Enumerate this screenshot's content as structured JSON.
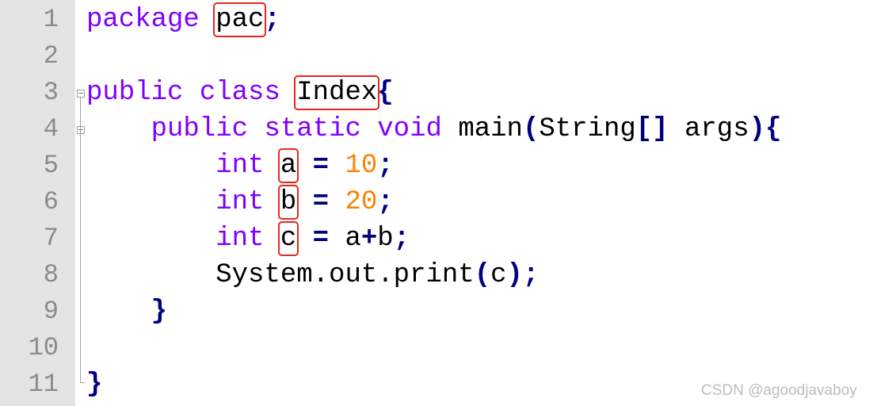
{
  "editor": {
    "lines": [
      {
        "n": "1",
        "tokens": [
          [
            "kw",
            "package"
          ],
          [
            "sp",
            " "
          ],
          [
            "box",
            "pac"
          ],
          [
            "op",
            ";"
          ]
        ]
      },
      {
        "n": "2",
        "tokens": []
      },
      {
        "n": "3",
        "tokens": [
          [
            "kw",
            "public"
          ],
          [
            "sp",
            " "
          ],
          [
            "kw",
            "class"
          ],
          [
            "sp",
            " "
          ],
          [
            "box",
            "Index"
          ],
          [
            "op",
            "{"
          ]
        ]
      },
      {
        "n": "4",
        "tokens": [
          [
            "sp",
            "    "
          ],
          [
            "kw",
            "public"
          ],
          [
            "sp",
            " "
          ],
          [
            "kw",
            "static"
          ],
          [
            "sp",
            " "
          ],
          [
            "kw",
            "void"
          ],
          [
            "sp",
            " "
          ],
          [
            "txt",
            "main"
          ],
          [
            "op",
            "("
          ],
          [
            "txt",
            "String"
          ],
          [
            "op",
            "[]"
          ],
          [
            "sp",
            " "
          ],
          [
            "txt",
            "args"
          ],
          [
            "op",
            ")"
          ],
          [
            "op",
            "{"
          ]
        ]
      },
      {
        "n": "5",
        "tokens": [
          [
            "sp",
            "        "
          ],
          [
            "kw",
            "int"
          ],
          [
            "sp",
            " "
          ],
          [
            "box",
            "a"
          ],
          [
            "sp",
            " "
          ],
          [
            "op",
            "="
          ],
          [
            "sp",
            " "
          ],
          [
            "num",
            "10"
          ],
          [
            "op",
            ";"
          ]
        ]
      },
      {
        "n": "6",
        "tokens": [
          [
            "sp",
            "        "
          ],
          [
            "kw",
            "int"
          ],
          [
            "sp",
            " "
          ],
          [
            "box",
            "b"
          ],
          [
            "sp",
            " "
          ],
          [
            "op",
            "="
          ],
          [
            "sp",
            " "
          ],
          [
            "num",
            "20"
          ],
          [
            "op",
            ";"
          ]
        ]
      },
      {
        "n": "7",
        "tokens": [
          [
            "sp",
            "        "
          ],
          [
            "kw",
            "int"
          ],
          [
            "sp",
            " "
          ],
          [
            "box",
            "c"
          ],
          [
            "sp",
            " "
          ],
          [
            "op",
            "="
          ],
          [
            "sp",
            " "
          ],
          [
            "txt",
            "a"
          ],
          [
            "op",
            "+"
          ],
          [
            "txt",
            "b"
          ],
          [
            "op",
            ";"
          ]
        ]
      },
      {
        "n": "8",
        "tokens": [
          [
            "sp",
            "        "
          ],
          [
            "txt",
            "System.out.print"
          ],
          [
            "op",
            "("
          ],
          [
            "txt",
            "c"
          ],
          [
            "op",
            ")"
          ],
          [
            "op",
            ";"
          ]
        ]
      },
      {
        "n": "9",
        "tokens": [
          [
            "sp",
            "    "
          ],
          [
            "op",
            "}"
          ]
        ]
      },
      {
        "n": "10",
        "tokens": []
      },
      {
        "n": "11",
        "tokens": [
          [
            "op",
            "}"
          ]
        ]
      }
    ]
  },
  "watermark": "CSDN @agoodjavaboy ⁡"
}
